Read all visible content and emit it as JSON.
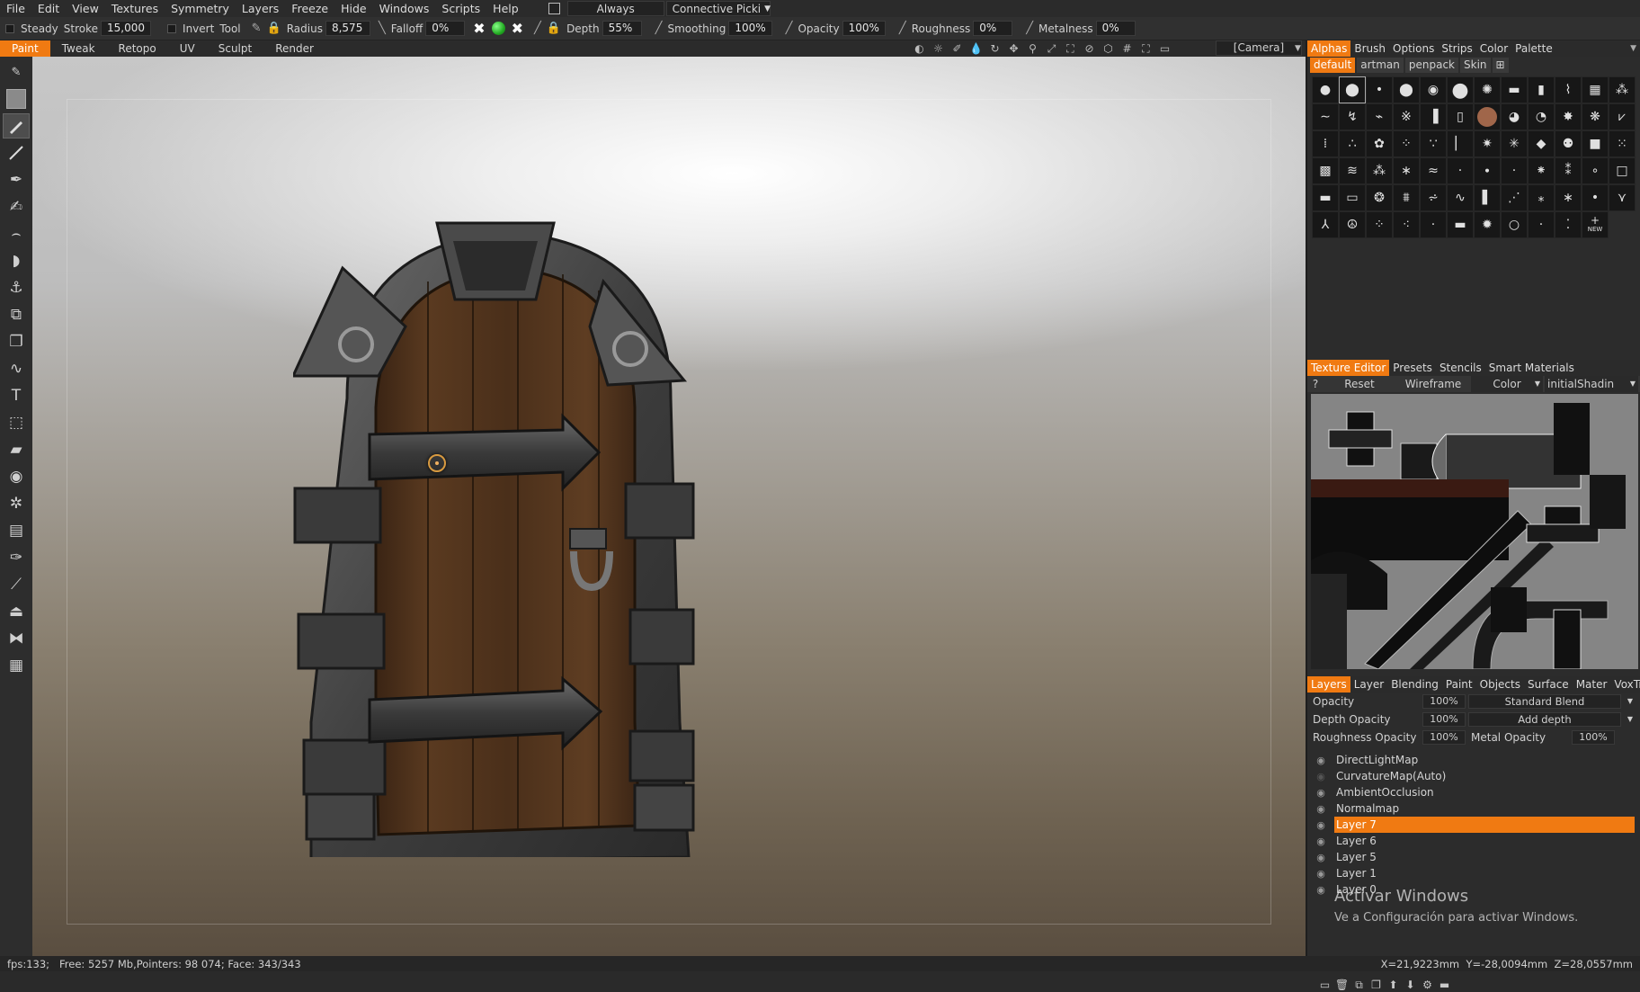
{
  "menu": {
    "items": [
      "File",
      "Edit",
      "View",
      "Textures",
      "Symmetry",
      "Layers",
      "Freeze",
      "Hide",
      "Windows",
      "Scripts",
      "Help"
    ],
    "always": "Always",
    "connective": "Connective Picki"
  },
  "toolbar": {
    "steady_label": "Steady",
    "stroke_label": "Stroke",
    "stroke_value": "15,000",
    "invert_label": "Invert",
    "tool_label": "Tool",
    "radius_label": "Radius",
    "radius_value": "8,575",
    "falloff_label": "Falloff",
    "falloff_value": "0%",
    "depth_label": "Depth",
    "depth_value": "55%",
    "smoothing_label": "Smoothing",
    "smoothing_value": "100%",
    "opacity_label": "Opacity",
    "opacity_value": "100%",
    "roughness_label": "Roughness",
    "roughness_value": "0%",
    "metalness_label": "Metalness",
    "metalness_value": "0%"
  },
  "modes": [
    "Paint",
    "Tweak",
    "Retopo",
    "UV",
    "Sculpt",
    "Render"
  ],
  "active_mode": "Paint",
  "camera": "[Camera]",
  "right_panel": {
    "top_tabs": [
      "Alphas",
      "Brush",
      "Options",
      "Strips",
      "Color",
      "Palette"
    ],
    "alpha_subtabs": [
      "default",
      "artman",
      "penpack",
      "Skin"
    ],
    "new_label": "NEW",
    "texture_tabs": [
      "Texture Editor",
      "Presets",
      "Stencils",
      "Smart Materials"
    ],
    "texture_controls": {
      "help": "?",
      "reset": "Reset",
      "wireframe": "Wireframe",
      "color": "Color",
      "shader": "initialShadin"
    },
    "layer_tabs": [
      "Layers",
      "Layer",
      "Blending",
      "Paint",
      "Objects",
      "Surface",
      "Mater",
      "VoxTree"
    ],
    "layer_props": {
      "opacity_label": "Opacity",
      "opacity_value": "100%",
      "blend_mode": "Standard Blend",
      "depth_opacity_label": "Depth Opacity",
      "depth_opacity_value": "100%",
      "depth_mode": "Add depth",
      "roughness_opacity_label": "Roughness Opacity",
      "roughness_opacity_value": "100%",
      "metal_opacity_label": "Metal Opacity",
      "metal_opacity_value": "100%"
    },
    "layers": [
      "DirectLightMap",
      "CurvatureMap(Auto)",
      "AmbientOcclusion",
      "Normalmap",
      "Layer 7",
      "Layer 6",
      "Layer 5",
      "Layer 1",
      "Layer 0"
    ],
    "selected_layer": "Layer 7"
  },
  "watermark": {
    "line1": "Activar Windows",
    "line2": "Ve a Configuración para activar Windows."
  },
  "status": {
    "left": "fps:133;   Free: 5257 Mb,Pointers: 98 074; Face: 343/343",
    "right": "X=21,9223mm  Y=-28,0094mm  Z=28,0557mm"
  },
  "colors": {
    "accent": "#f07a12",
    "panel": "#2c2c2c"
  }
}
